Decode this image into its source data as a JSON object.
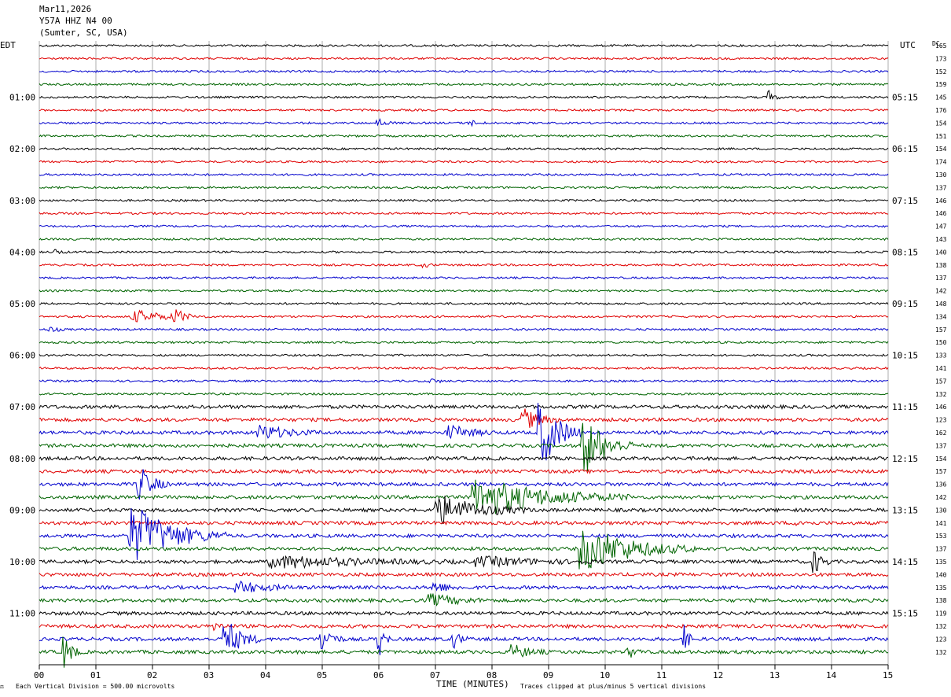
{
  "header": {
    "date": "Mar11,2026",
    "station": "Y57A HHZ N4 00",
    "location": "(Sumter, SC, USA)"
  },
  "left_axis_label": "EDT",
  "right_axis_label": "UTC",
  "dc_label": "DC",
  "footer": {
    "xlabel": "TIME (MINUTES)",
    "scale_note": "Each Vertical Division =  500.00 microvolts",
    "clip_note": "Traces clipped at plus/minus 5 vertical divisions"
  },
  "chart_data": {
    "type": "line",
    "title": "",
    "xlabel": "TIME (MINUTES)",
    "xlim": [
      0,
      15
    ],
    "x_ticks": [
      "00",
      "01",
      "02",
      "03",
      "04",
      "05",
      "06",
      "07",
      "08",
      "09",
      "10",
      "11",
      "12",
      "13",
      "14",
      "15"
    ],
    "trace_colors": [
      "#000000",
      "#e00000",
      "#0000cc",
      "#006400"
    ],
    "left_time_labels": [
      "01:00",
      "02:00",
      "03:00",
      "04:00",
      "05:00",
      "06:00",
      "07:00",
      "08:00",
      "09:00",
      "10:00",
      "11:00"
    ],
    "right_time_labels": [
      "05:15",
      "06:15",
      "07:15",
      "08:15",
      "09:15",
      "10:15",
      "11:15",
      "12:15",
      "13:15",
      "14:15",
      "15:15"
    ],
    "dc_values": [
      "165",
      "173",
      "152",
      "159",
      "145",
      "176",
      "154",
      "151",
      "154",
      "174",
      "130",
      "137",
      "146",
      "146",
      "147",
      "143",
      "140",
      "138",
      "137",
      "142",
      "148",
      "134",
      "157",
      "150",
      "133",
      "141",
      "157",
      "132",
      "146",
      "123",
      "162",
      "137",
      "154",
      "157",
      "136",
      "142",
      "130",
      "141",
      "153",
      "137",
      "135",
      "140",
      "135",
      "138",
      "119",
      "132",
      "123",
      "132"
    ],
    "events": [
      {
        "row": 4,
        "minute": 12.9,
        "amp": 1.0,
        "dur": 0.2
      },
      {
        "row": 6,
        "minute": 6.0,
        "amp": 0.6,
        "dur": 0.3
      },
      {
        "row": 6,
        "minute": 7.6,
        "amp": 0.5,
        "dur": 0.3
      },
      {
        "row": 17,
        "minute": 6.8,
        "amp": 0.4,
        "dur": 0.2
      },
      {
        "row": 16,
        "minute": 0.3,
        "amp": 0.4,
        "dur": 0.2
      },
      {
        "row": 21,
        "minute": 2.4,
        "amp": 1.2,
        "dur": 0.3
      },
      {
        "row": 21,
        "minute": 1.8,
        "amp": 0.8,
        "dur": 1.2
      },
      {
        "row": 22,
        "minute": 0.2,
        "amp": 0.4,
        "dur": 0.3
      },
      {
        "row": 26,
        "minute": 6.9,
        "amp": 0.4,
        "dur": 0.3
      },
      {
        "row": 29,
        "minute": 8.6,
        "amp": 1.5,
        "dur": 0.6
      },
      {
        "row": 30,
        "minute": 8.9,
        "amp": 5.0,
        "dur": 0.7
      },
      {
        "row": 30,
        "minute": 4.0,
        "amp": 1.0,
        "dur": 1.0
      },
      {
        "row": 30,
        "minute": 7.3,
        "amp": 1.0,
        "dur": 0.8
      },
      {
        "row": 31,
        "minute": 9.7,
        "amp": 4.0,
        "dur": 0.8
      },
      {
        "row": 34,
        "minute": 1.8,
        "amp": 2.5,
        "dur": 0.5
      },
      {
        "row": 35,
        "minute": 8.0,
        "amp": 2.5,
        "dur": 2.5
      },
      {
        "row": 36,
        "minute": 7.2,
        "amp": 2.0,
        "dur": 1.5
      },
      {
        "row": 37,
        "minute": 13.4,
        "amp": 0.5,
        "dur": 0.3
      },
      {
        "row": 38,
        "minute": 1.8,
        "amp": 4.0,
        "dur": 1.5
      },
      {
        "row": 39,
        "minute": 9.8,
        "amp": 3.0,
        "dur": 1.8
      },
      {
        "row": 40,
        "minute": 13.7,
        "amp": 1.8,
        "dur": 0.3
      },
      {
        "row": 40,
        "minute": 4.5,
        "amp": 0.8,
        "dur": 3.0
      },
      {
        "row": 40,
        "minute": 8.0,
        "amp": 0.6,
        "dur": 2.0
      },
      {
        "row": 42,
        "minute": 3.6,
        "amp": 0.8,
        "dur": 1.0
      },
      {
        "row": 42,
        "minute": 7.0,
        "amp": 0.8,
        "dur": 0.5
      },
      {
        "row": 43,
        "minute": 7.0,
        "amp": 0.8,
        "dur": 1.0
      },
      {
        "row": 45,
        "minute": 3.1,
        "amp": 1.0,
        "dur": 0.2
      },
      {
        "row": 46,
        "minute": 3.3,
        "amp": 3.0,
        "dur": 0.6
      },
      {
        "row": 46,
        "minute": 5.0,
        "amp": 2.0,
        "dur": 0.4
      },
      {
        "row": 46,
        "minute": 6.0,
        "amp": 3.0,
        "dur": 0.2
      },
      {
        "row": 46,
        "minute": 7.3,
        "amp": 1.5,
        "dur": 0.3
      },
      {
        "row": 46,
        "minute": 11.4,
        "amp": 2.0,
        "dur": 0.2
      },
      {
        "row": 47,
        "minute": 0.45,
        "amp": 2.5,
        "dur": 0.3
      },
      {
        "row": 47,
        "minute": 8.4,
        "amp": 1.0,
        "dur": 0.6
      },
      {
        "row": 47,
        "minute": 10.4,
        "amp": 1.0,
        "dur": 0.3
      }
    ]
  }
}
